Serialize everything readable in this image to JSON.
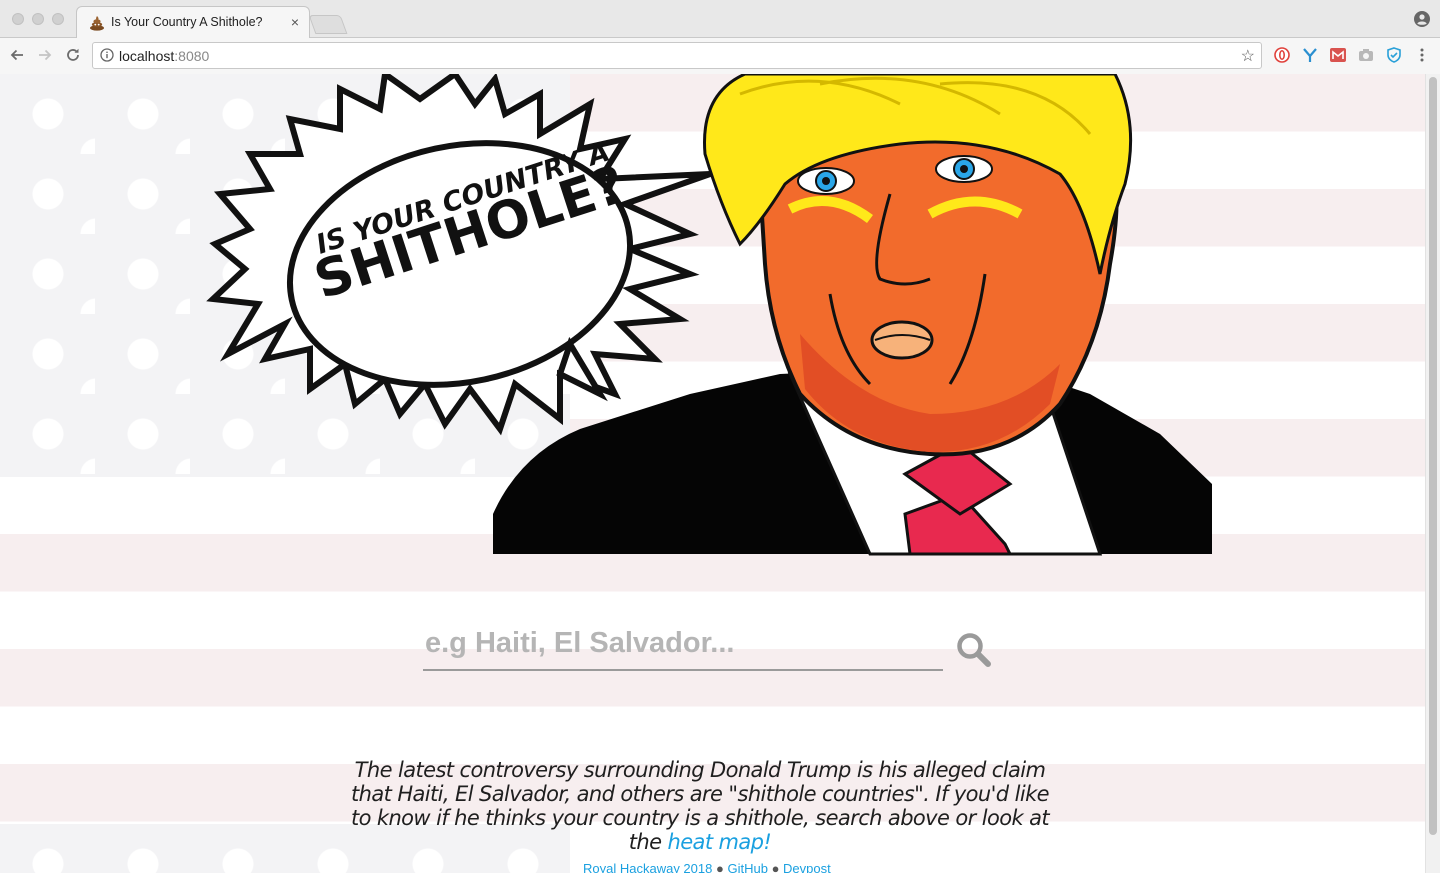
{
  "browser": {
    "tab_title": "Is Your Country A Shithole?",
    "tab_close": "×",
    "url_host": "localhost",
    "url_port": ":8080",
    "bookmark_star": "☆"
  },
  "hero": {
    "bubble_line1": "IS YOUR COUNTRY A",
    "bubble_line2": "SHITHOLE?"
  },
  "search": {
    "placeholder": "e.g Haiti, El Salvador..."
  },
  "description": {
    "text_before": "The latest controversy surrounding Donald Trump is his alleged claim that Haiti, El Salvador, and others are \"shithole countries\". If you'd like to know if he thinks ",
    "emphasis": "your",
    "text_after": " country is a shithole, search above or look at the ",
    "link": "heat map!"
  },
  "footer": {
    "link1": "Royal Hackaway 2018",
    "link2": "GitHub",
    "link3": "Devpost",
    "separator": "●"
  },
  "colors": {
    "link": "#1aa0e0",
    "stripe": "#f7eeef",
    "hair": "#ffe81a",
    "skin": "#f26b2c",
    "tie": "#e8294f"
  }
}
